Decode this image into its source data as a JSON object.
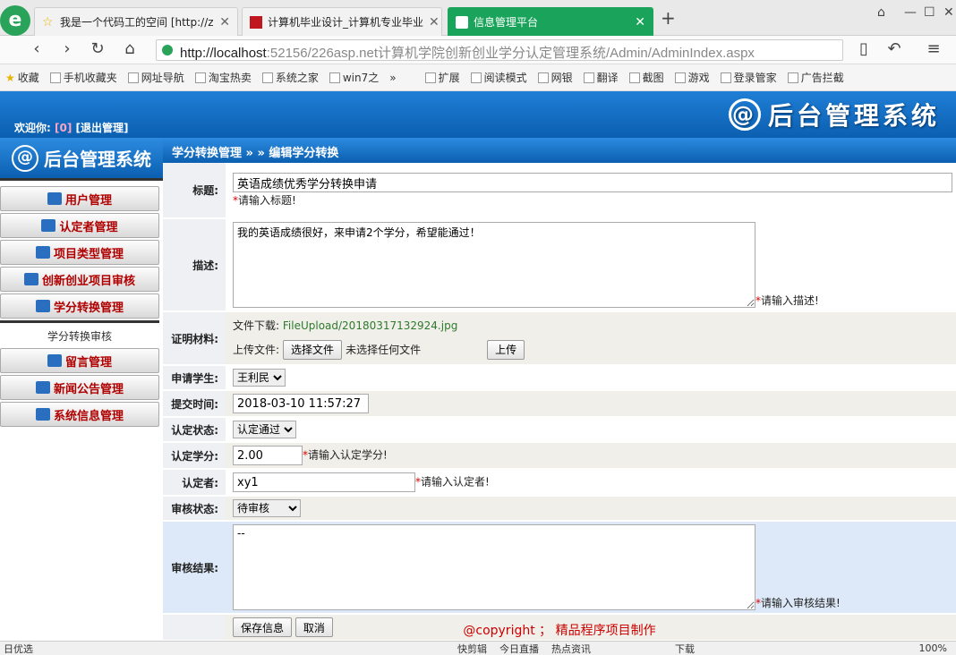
{
  "browser": {
    "tabs": [
      {
        "label": "我是一个代码工的空间 [http://z",
        "active": false
      },
      {
        "label": "计算机毕业设计_计算机专业毕业",
        "active": false
      },
      {
        "label": "信息管理平台",
        "active": true
      }
    ],
    "new_tab": "+",
    "url_host": "http://localhost",
    "url_rest": ":52156/226asp.net计算机学院创新创业学分认定管理系统/Admin/AdminIndex.aspx",
    "bookmarks": [
      "收藏",
      "手机收藏夹",
      "网址导航",
      "淘宝热卖",
      "系统之家",
      "win7之",
      "»"
    ],
    "tools": [
      "扩展",
      "阅读模式",
      "网银",
      "翻译",
      "截图",
      "游戏",
      "登录管家",
      "广告拦截"
    ]
  },
  "header": {
    "welcome_prefix": "欢迎你:",
    "user": "[0]",
    "logout": "[退出管理]",
    "title": "后台管理系统"
  },
  "sidebar": {
    "title": "后台管理系统",
    "items": [
      "用户管理",
      "认定者管理",
      "项目类型管理",
      "创新创业项目审核",
      "学分转换管理"
    ],
    "sub_item": "学分转换审核",
    "items2": [
      "留言管理",
      "新闻公告管理",
      "系统信息管理"
    ]
  },
  "breadcrumb": "学分转换管理 » » 编辑学分转换",
  "form": {
    "title_label": "标题:",
    "title_value": "英语成绩优秀学分转换申请",
    "title_hint": "请输入标题!",
    "desc_label": "描述:",
    "desc_value": "我的英语成绩很好，来申请2个学分，希望能通过！",
    "desc_hint": "请输入描述!",
    "proof_label": "证明材料:",
    "download_label": "文件下载:",
    "download_file": "FileUpload/20180317132924.jpg",
    "upload_label": "上传文件:",
    "choose_file": "选择文件",
    "no_file": "未选择任何文件",
    "upload_button": "上传",
    "student_label": "申请学生:",
    "student_value": "王利民",
    "submit_time_label": "提交时间:",
    "submit_time_value": "2018-03-10 11:57:27",
    "status_label": "认定状态:",
    "status_value": "认定通过",
    "credit_label": "认定学分:",
    "credit_value": "2.00",
    "credit_hint": "请输入认定学分!",
    "certifier_label": "认定者:",
    "certifier_value": "xy1",
    "certifier_hint": "请输入认定者!",
    "review_status_label": "审核状态:",
    "review_status_value": "待审核",
    "review_result_label": "审核结果:",
    "review_result_value": "--",
    "review_result_hint": "请输入审核结果!",
    "save_button": "保存信息",
    "cancel_button": "取消"
  },
  "footer": "@copyright ； 精品程序项目制作",
  "status_bar": {
    "left": "日优选",
    "items": [
      "快剪辑",
      "今日直播",
      "热点资讯",
      "下载"
    ],
    "zoom": "100%"
  }
}
